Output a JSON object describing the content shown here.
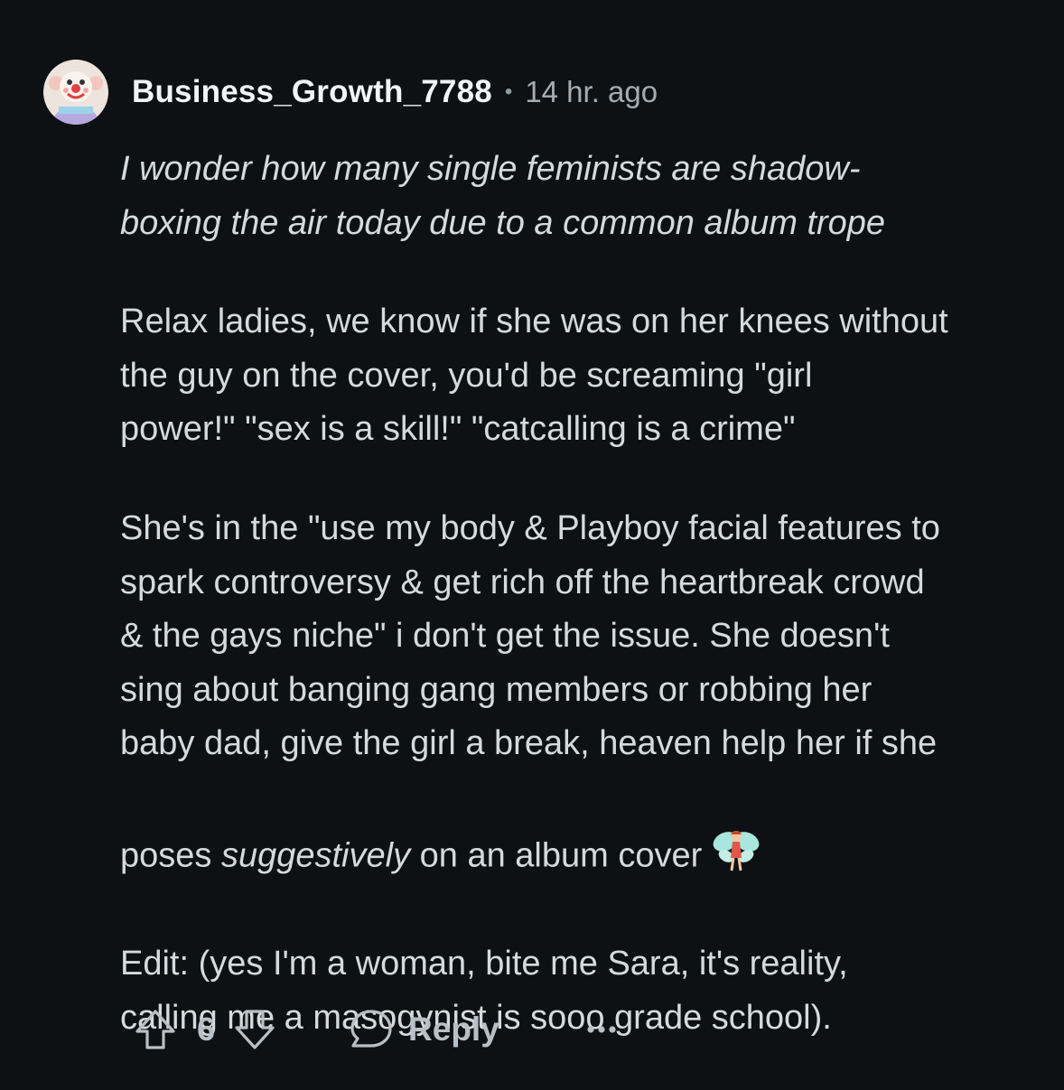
{
  "comment": {
    "author": "Business_Growth_7788",
    "separator": "•",
    "timestamp": "14 hr. ago",
    "avatar_icon": "clown-avatar-icon",
    "paragraphs": {
      "p1": "I wonder how many single feminists are shadow-\nboxing the air today due to a common album trope",
      "p2": "Relax ladies, we know if she was on her knees without\nthe guy on the cover, you'd be screaming \"girl\npower!\" \"sex is a skill!\" \"catcalling is a crime\"",
      "p3_before": "She's in the \"use my body & Playboy facial features to\nspark controversy & get rich off the heartbreak crowd\n& the gays niche\" i don't get the issue. She doesn't\nsing about banging gang members or robbing her\nbaby dad, give the girl a break, heaven help her if she\nposes ",
      "p3_emphasis": "suggestively",
      "p3_after": " on an album cover",
      "p3_emoji_icon": "fairy-emoji-icon",
      "p4": "Edit: (yes I'm a woman, bite me Sara, it's reality,\ncalling me a masogynist is sooo grade school)."
    },
    "score": "6",
    "reply_label": "Reply"
  },
  "icons": {
    "upvote": "upvote-arrow-icon",
    "downvote": "downvote-arrow-icon",
    "reply": "speech-bubble-icon",
    "more": "ellipsis-icon"
  },
  "colors": {
    "background": "#0e1113",
    "username": "#f2f4f5",
    "body_text": "#d5dadd",
    "meta_text": "#a5adb2",
    "action_text": "#b8c0c5"
  }
}
